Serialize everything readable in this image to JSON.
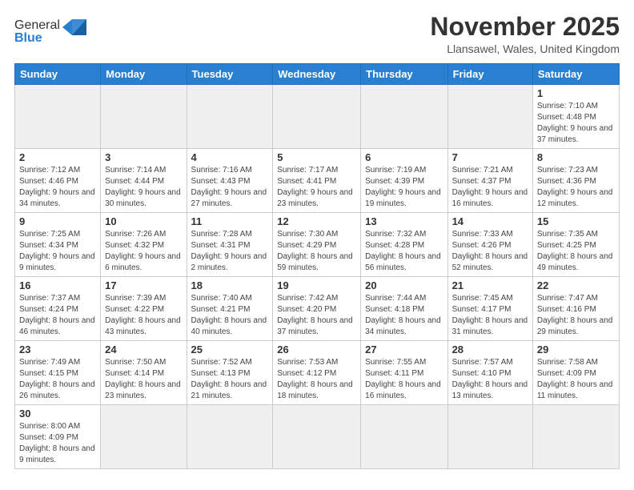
{
  "header": {
    "logo_general": "General",
    "logo_blue": "Blue",
    "month_title": "November 2025",
    "subtitle": "Llansawel, Wales, United Kingdom"
  },
  "weekdays": [
    "Sunday",
    "Monday",
    "Tuesday",
    "Wednesday",
    "Thursday",
    "Friday",
    "Saturday"
  ],
  "weeks": [
    [
      {
        "day": "",
        "info": ""
      },
      {
        "day": "",
        "info": ""
      },
      {
        "day": "",
        "info": ""
      },
      {
        "day": "",
        "info": ""
      },
      {
        "day": "",
        "info": ""
      },
      {
        "day": "",
        "info": ""
      },
      {
        "day": "1",
        "info": "Sunrise: 7:10 AM\nSunset: 4:48 PM\nDaylight: 9 hours\nand 37 minutes."
      }
    ],
    [
      {
        "day": "2",
        "info": "Sunrise: 7:12 AM\nSunset: 4:46 PM\nDaylight: 9 hours\nand 34 minutes."
      },
      {
        "day": "3",
        "info": "Sunrise: 7:14 AM\nSunset: 4:44 PM\nDaylight: 9 hours\nand 30 minutes."
      },
      {
        "day": "4",
        "info": "Sunrise: 7:16 AM\nSunset: 4:43 PM\nDaylight: 9 hours\nand 27 minutes."
      },
      {
        "day": "5",
        "info": "Sunrise: 7:17 AM\nSunset: 4:41 PM\nDaylight: 9 hours\nand 23 minutes."
      },
      {
        "day": "6",
        "info": "Sunrise: 7:19 AM\nSunset: 4:39 PM\nDaylight: 9 hours\nand 19 minutes."
      },
      {
        "day": "7",
        "info": "Sunrise: 7:21 AM\nSunset: 4:37 PM\nDaylight: 9 hours\nand 16 minutes."
      },
      {
        "day": "8",
        "info": "Sunrise: 7:23 AM\nSunset: 4:36 PM\nDaylight: 9 hours\nand 12 minutes."
      }
    ],
    [
      {
        "day": "9",
        "info": "Sunrise: 7:25 AM\nSunset: 4:34 PM\nDaylight: 9 hours\nand 9 minutes."
      },
      {
        "day": "10",
        "info": "Sunrise: 7:26 AM\nSunset: 4:32 PM\nDaylight: 9 hours\nand 6 minutes."
      },
      {
        "day": "11",
        "info": "Sunrise: 7:28 AM\nSunset: 4:31 PM\nDaylight: 9 hours\nand 2 minutes."
      },
      {
        "day": "12",
        "info": "Sunrise: 7:30 AM\nSunset: 4:29 PM\nDaylight: 8 hours\nand 59 minutes."
      },
      {
        "day": "13",
        "info": "Sunrise: 7:32 AM\nSunset: 4:28 PM\nDaylight: 8 hours\nand 56 minutes."
      },
      {
        "day": "14",
        "info": "Sunrise: 7:33 AM\nSunset: 4:26 PM\nDaylight: 8 hours\nand 52 minutes."
      },
      {
        "day": "15",
        "info": "Sunrise: 7:35 AM\nSunset: 4:25 PM\nDaylight: 8 hours\nand 49 minutes."
      }
    ],
    [
      {
        "day": "16",
        "info": "Sunrise: 7:37 AM\nSunset: 4:24 PM\nDaylight: 8 hours\nand 46 minutes."
      },
      {
        "day": "17",
        "info": "Sunrise: 7:39 AM\nSunset: 4:22 PM\nDaylight: 8 hours\nand 43 minutes."
      },
      {
        "day": "18",
        "info": "Sunrise: 7:40 AM\nSunset: 4:21 PM\nDaylight: 8 hours\nand 40 minutes."
      },
      {
        "day": "19",
        "info": "Sunrise: 7:42 AM\nSunset: 4:20 PM\nDaylight: 8 hours\nand 37 minutes."
      },
      {
        "day": "20",
        "info": "Sunrise: 7:44 AM\nSunset: 4:18 PM\nDaylight: 8 hours\nand 34 minutes."
      },
      {
        "day": "21",
        "info": "Sunrise: 7:45 AM\nSunset: 4:17 PM\nDaylight: 8 hours\nand 31 minutes."
      },
      {
        "day": "22",
        "info": "Sunrise: 7:47 AM\nSunset: 4:16 PM\nDaylight: 8 hours\nand 29 minutes."
      }
    ],
    [
      {
        "day": "23",
        "info": "Sunrise: 7:49 AM\nSunset: 4:15 PM\nDaylight: 8 hours\nand 26 minutes."
      },
      {
        "day": "24",
        "info": "Sunrise: 7:50 AM\nSunset: 4:14 PM\nDaylight: 8 hours\nand 23 minutes."
      },
      {
        "day": "25",
        "info": "Sunrise: 7:52 AM\nSunset: 4:13 PM\nDaylight: 8 hours\nand 21 minutes."
      },
      {
        "day": "26",
        "info": "Sunrise: 7:53 AM\nSunset: 4:12 PM\nDaylight: 8 hours\nand 18 minutes."
      },
      {
        "day": "27",
        "info": "Sunrise: 7:55 AM\nSunset: 4:11 PM\nDaylight: 8 hours\nand 16 minutes."
      },
      {
        "day": "28",
        "info": "Sunrise: 7:57 AM\nSunset: 4:10 PM\nDaylight: 8 hours\nand 13 minutes."
      },
      {
        "day": "29",
        "info": "Sunrise: 7:58 AM\nSunset: 4:09 PM\nDaylight: 8 hours\nand 11 minutes."
      }
    ],
    [
      {
        "day": "30",
        "info": "Sunrise: 8:00 AM\nSunset: 4:09 PM\nDaylight: 8 hours\nand 9 minutes."
      },
      {
        "day": "",
        "info": ""
      },
      {
        "day": "",
        "info": ""
      },
      {
        "day": "",
        "info": ""
      },
      {
        "day": "",
        "info": ""
      },
      {
        "day": "",
        "info": ""
      },
      {
        "day": "",
        "info": ""
      }
    ]
  ]
}
